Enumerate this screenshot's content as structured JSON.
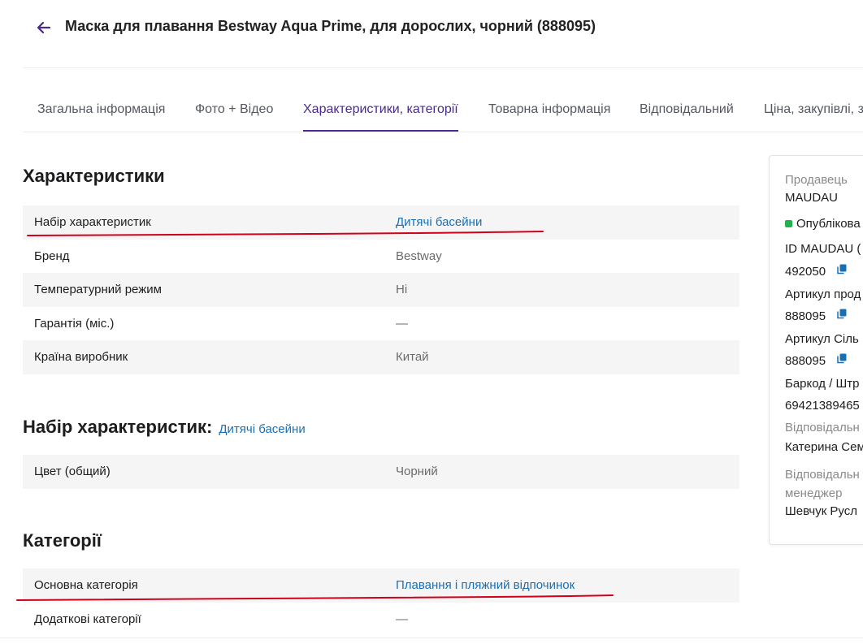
{
  "header": {
    "title": "Маска для плавання Bestway Aqua Prime, для дорослих, чорний (888095)"
  },
  "tabs": [
    {
      "label": "Загальна інформація"
    },
    {
      "label": "Фото + Відео"
    },
    {
      "label": "Характеристики, категорії"
    },
    {
      "label": "Товарна інформація"
    },
    {
      "label": "Відповідальний"
    },
    {
      "label": "Ціна, закупівлі, з"
    }
  ],
  "characteristics": {
    "title": "Характеристики",
    "rows": [
      {
        "key": "Набір характеристик",
        "value": "Дитячі басейни"
      },
      {
        "key": "Бренд",
        "value": "Bestway"
      },
      {
        "key": "Температурний режим",
        "value": "Ні"
      },
      {
        "key": "Гарантія (міс.)",
        "value": "—"
      },
      {
        "key": "Країна виробник",
        "value": "Китай"
      }
    ]
  },
  "charset": {
    "title": "Набір характеристик:",
    "link": "Дитячі басейни",
    "rows": [
      {
        "key": "Цвет (общий)",
        "value": "Чорний"
      }
    ]
  },
  "categories": {
    "title": "Категорії",
    "rows": [
      {
        "key": "Основна категорія",
        "value": "Плавання і пляжний відпочинок"
      },
      {
        "key": "Додаткові категорії",
        "value": "—"
      }
    ]
  },
  "side": {
    "seller_label": "Продавець",
    "seller_value": "MAUDAU",
    "status": "Опублікова",
    "id_label": "ID MAUDAU (",
    "id_value": "492050",
    "article_seller_label": "Артикул прод",
    "article_seller_value": "888095",
    "article_sil_label": "Артикул Сіль",
    "article_sil_value": "888095",
    "barcode_label": "Баркод / Штр",
    "barcode_value": "69421389465",
    "responsible_label": "Відповідальн",
    "responsible_value": "Катерина Сем",
    "manager_label_1": "Відповідальн",
    "manager_label_2": "менеджер",
    "manager_value": "Шевчук Русл"
  },
  "colors": {
    "accent": "#4a2a8a",
    "link": "#1a6fb3",
    "annotation": "#d0021b",
    "status": "#22b14c"
  },
  "icons": [
    "arrow-left-icon",
    "copy-icon",
    "status-dot-icon"
  ]
}
